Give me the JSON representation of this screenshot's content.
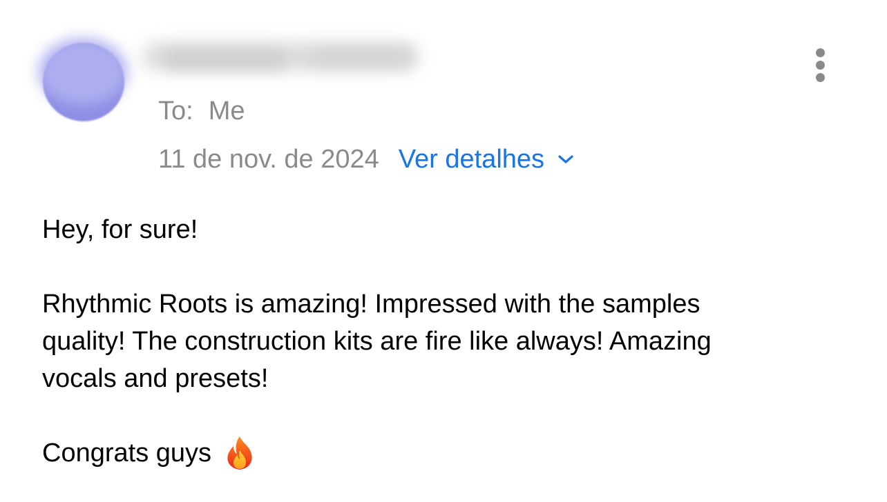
{
  "header": {
    "recipient_label": "To:",
    "recipient_value": "Me",
    "date": "11 de nov. de 2024",
    "details_link": "Ver detalhes"
  },
  "body": {
    "greeting": "Hey, for sure!",
    "paragraph_lines": [
      "Rhythmic Roots is amazing! Impressed with the samples",
      "quality! The construction kits are fire like always! Amazing",
      "vocals and presets!"
    ],
    "closing": "Congrats guys"
  },
  "icons": {
    "more": "more-vertical-icon",
    "chevron": "chevron-down-icon",
    "emoji": "fire-emoji-icon"
  },
  "colors": {
    "link": "#1a73e8",
    "secondary_text": "#8a8a8e",
    "avatar": "#8e8ee6"
  }
}
